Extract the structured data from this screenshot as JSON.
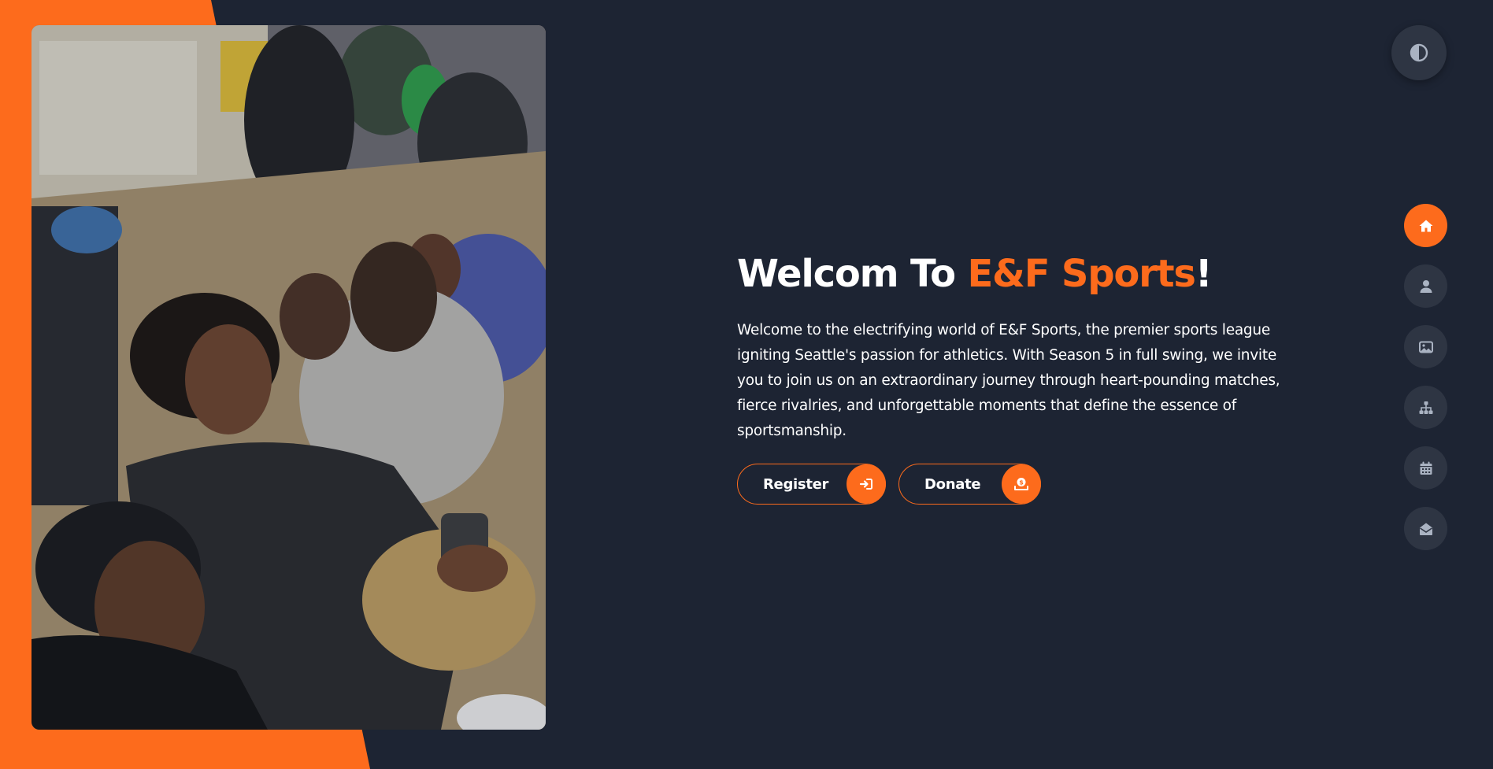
{
  "hero": {
    "title_prefix": "Welcom To ",
    "title_brand": "E&F Sports",
    "title_suffix": "!",
    "description": "Welcome to the electrifying world of E&F Sports, the premier sports league igniting Seattle's passion for athletics. With Season 5 in full swing, we invite you to join us on an extraordinary journey through heart-pounding matches, fierce rivalries, and unforgettable moments that define the essence of sportsmanship."
  },
  "actions": {
    "register_label": "Register",
    "register_icon": "sign-in-icon",
    "donate_label": "Donate",
    "donate_icon": "donate-icon"
  },
  "theme_toggle": {
    "icon": "contrast-icon"
  },
  "side_nav": {
    "items": [
      {
        "icon": "home-icon",
        "active": true
      },
      {
        "icon": "user-icon",
        "active": false
      },
      {
        "icon": "image-icon",
        "active": false
      },
      {
        "icon": "sitemap-icon",
        "active": false
      },
      {
        "icon": "calendar-icon",
        "active": false
      },
      {
        "icon": "envelope-open-icon",
        "active": false
      }
    ]
  },
  "colors": {
    "accent": "#fd6b1c",
    "background": "#1d2433",
    "button_dark": "#2e3543",
    "text": "#ffffff"
  }
}
